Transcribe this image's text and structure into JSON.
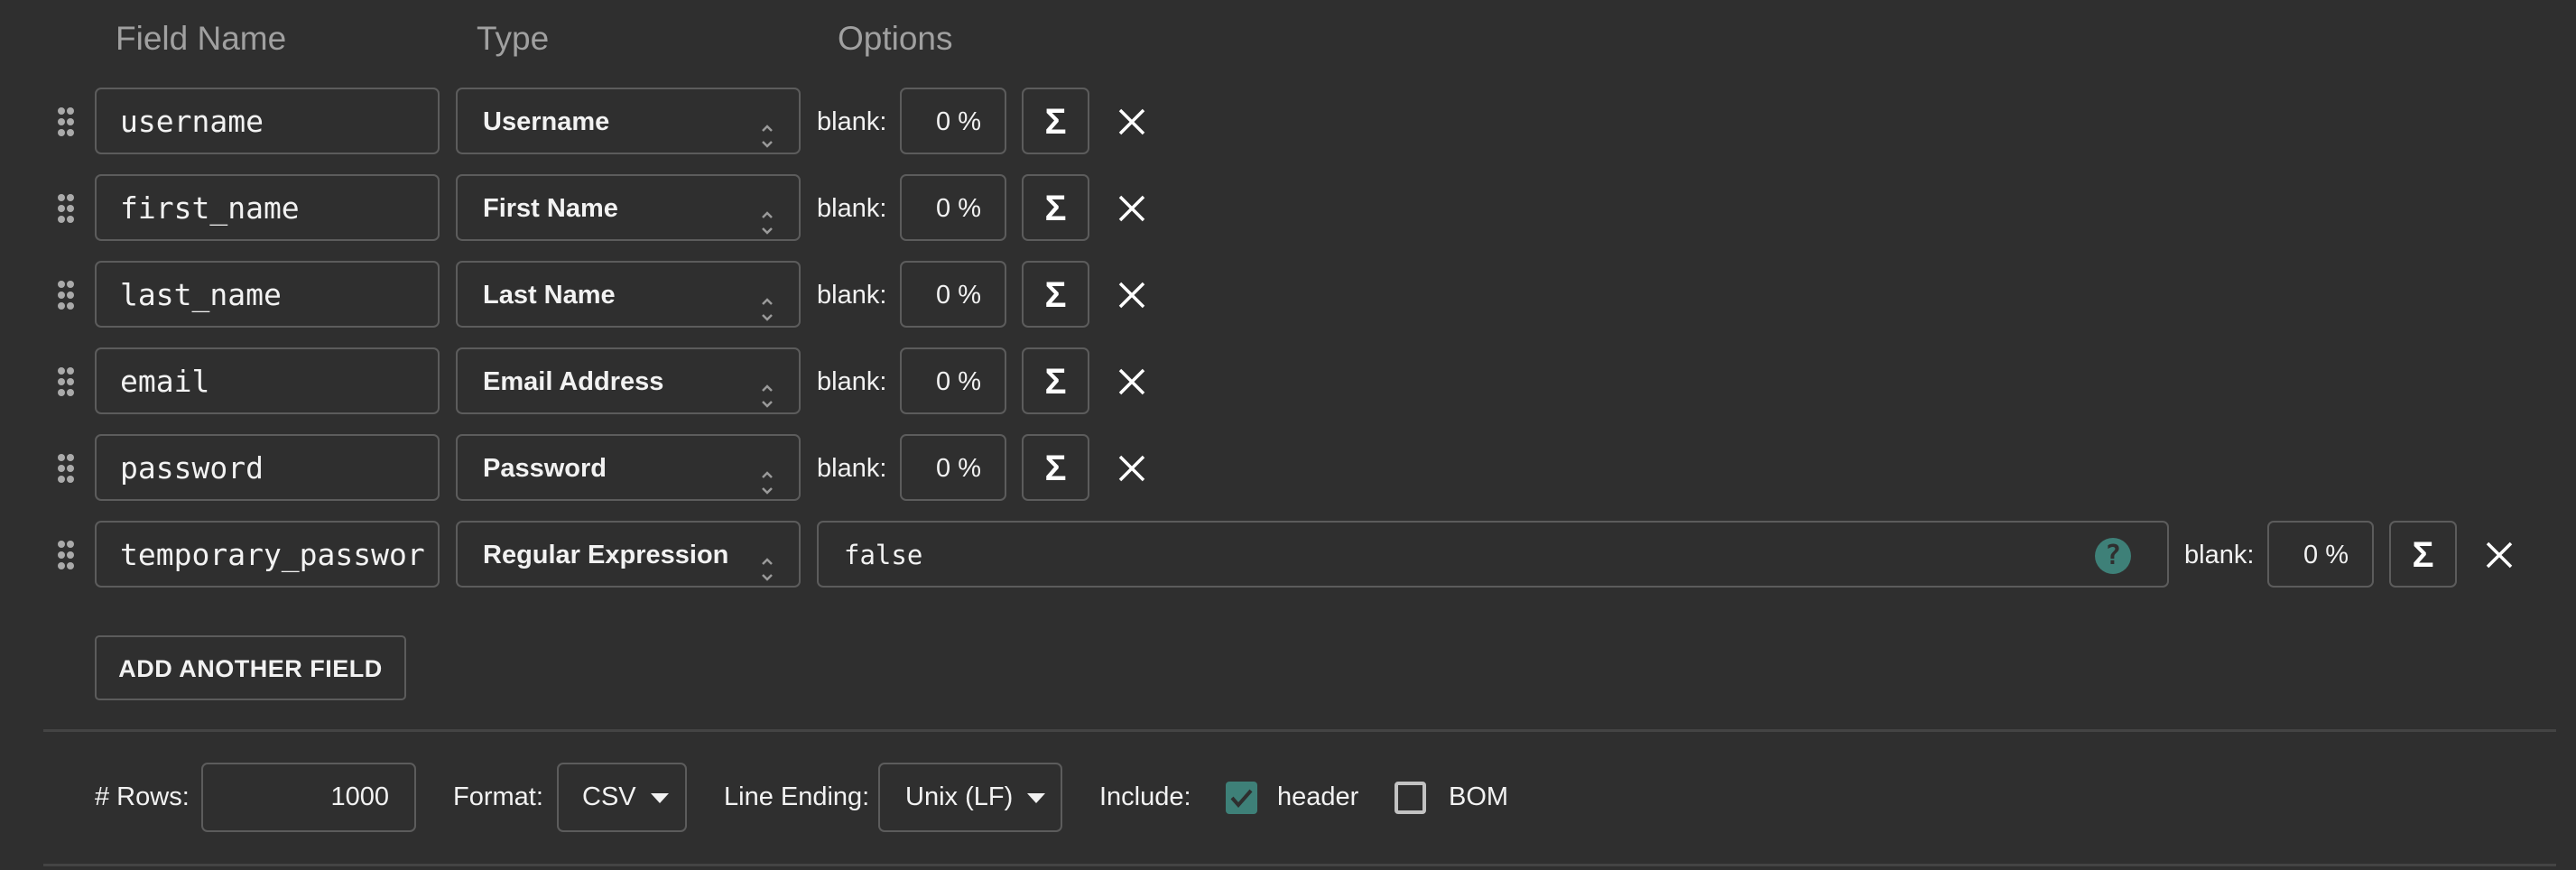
{
  "headers": {
    "field_name": "Field Name",
    "type": "Type",
    "options": "Options"
  },
  "fields": [
    {
      "name": "username",
      "type": "Username",
      "blank_label": "blank:",
      "blank_pct": "0 %"
    },
    {
      "name": "first_name",
      "type": "First Name",
      "blank_label": "blank:",
      "blank_pct": "0 %"
    },
    {
      "name": "last_name",
      "type": "Last Name",
      "blank_label": "blank:",
      "blank_pct": "0 %"
    },
    {
      "name": "email",
      "type": "Email Address",
      "blank_label": "blank:",
      "blank_pct": "0 %"
    },
    {
      "name": "password",
      "type": "Password",
      "blank_label": "blank:",
      "blank_pct": "0 %"
    },
    {
      "name": "temporary_passwor",
      "type": "Regular Expression",
      "regex_value": "false",
      "blank_label": "blank:",
      "blank_pct": "0 %"
    }
  ],
  "icons": {
    "sigma": "Σ",
    "help": "?",
    "close": "close-icon",
    "drag": "drag-handle-icon"
  },
  "add_button": "ADD ANOTHER FIELD",
  "footer": {
    "rows_label": "# Rows:",
    "rows_value": "1000",
    "format_label": "Format:",
    "format_value": "CSV",
    "line_ending_label": "Line Ending:",
    "line_ending_value": "Unix (LF)",
    "include_label": "Include:",
    "header_label": "header",
    "header_checked": true,
    "bom_label": "BOM",
    "bom_checked": false
  },
  "colors": {
    "accent": "#3e8078",
    "background": "#2f2f2f",
    "border": "#5c5c5c"
  }
}
